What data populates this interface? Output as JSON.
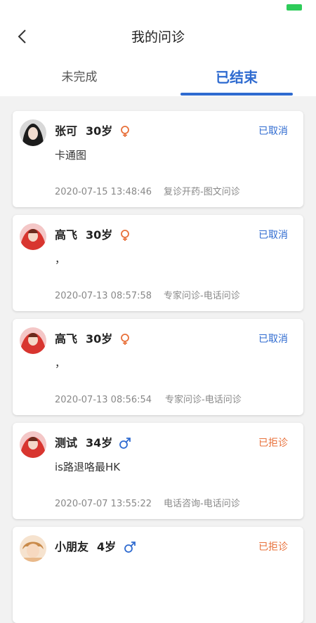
{
  "header": {
    "title": "我的问诊",
    "back_icon": "chevron-left-icon",
    "tabs": [
      {
        "label": "未完成",
        "active": false
      },
      {
        "label": "已结束",
        "active": true
      }
    ]
  },
  "colors": {
    "accent": "#2f6bd0",
    "cancelled": "#2f6bd0",
    "rejected": "#e8703a",
    "female": "#e8703a",
    "male": "#2f6bd0"
  },
  "consultations": [
    {
      "name": "张可",
      "age": "30岁",
      "gender": "female",
      "status": "已取消",
      "status_type": "cancelled",
      "desc": "卡通图",
      "time": "2020-07-15 13:48:46",
      "type": "复诊开药-图文问诊"
    },
    {
      "name": "高飞",
      "age": "30岁",
      "gender": "female",
      "status": "已取消",
      "status_type": "cancelled",
      "desc": "，",
      "time": "2020-07-13 08:57:58",
      "type": "专家问诊-电话问诊"
    },
    {
      "name": "高飞",
      "age": "30岁",
      "gender": "female",
      "status": "已取消",
      "status_type": "cancelled",
      "desc": "，",
      "time": "2020-07-13 08:56:54",
      "type": "专家问诊-电话问诊"
    },
    {
      "name": "测试",
      "age": "34岁",
      "gender": "male",
      "status": "已拒诊",
      "status_type": "rejected",
      "desc": "is路退咯最HK",
      "time": "2020-07-07 13:55:22",
      "type": "电话咨询-电话问诊"
    },
    {
      "name": "小朋友",
      "age": "4岁",
      "gender": "male",
      "status": "已拒诊",
      "status_type": "rejected",
      "desc": "",
      "time": "",
      "type": ""
    }
  ]
}
